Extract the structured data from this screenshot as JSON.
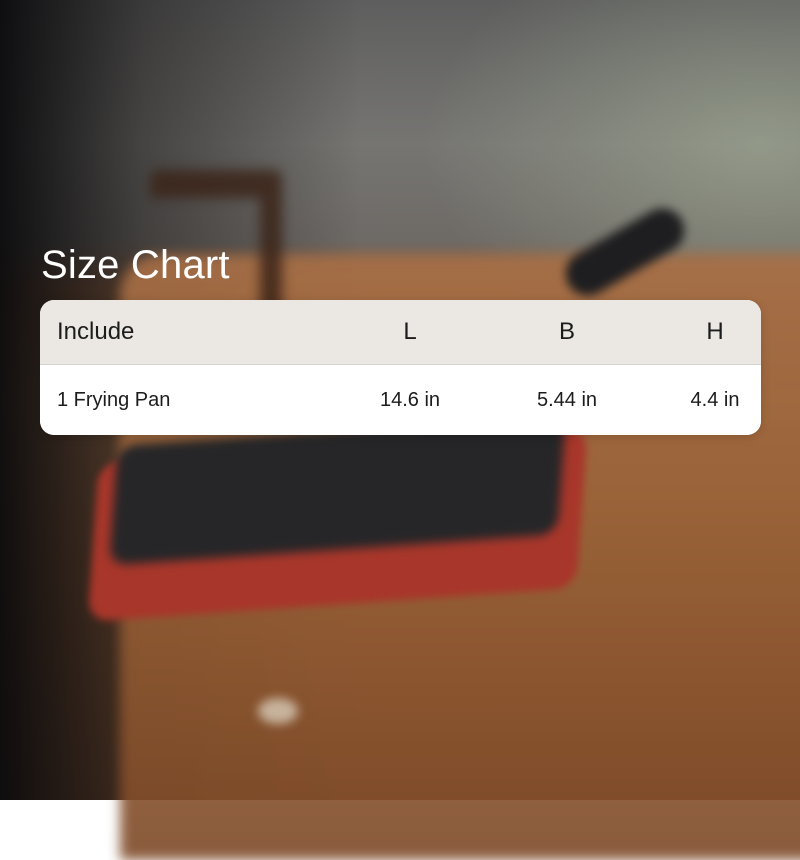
{
  "size_chart": {
    "title": "Size Chart",
    "headers": {
      "include": "Include",
      "length": "L",
      "breadth": "B",
      "height": "H"
    },
    "rows": [
      {
        "include": "1 Frying Pan",
        "length": "14.6 in",
        "breadth": "5.44 in",
        "height": "4.4 in"
      }
    ]
  },
  "colors": {
    "header_bg": "#ebe8e3",
    "row_bg": "#ffffff",
    "title_text": "#ffffff",
    "pan": "#a8362a"
  }
}
